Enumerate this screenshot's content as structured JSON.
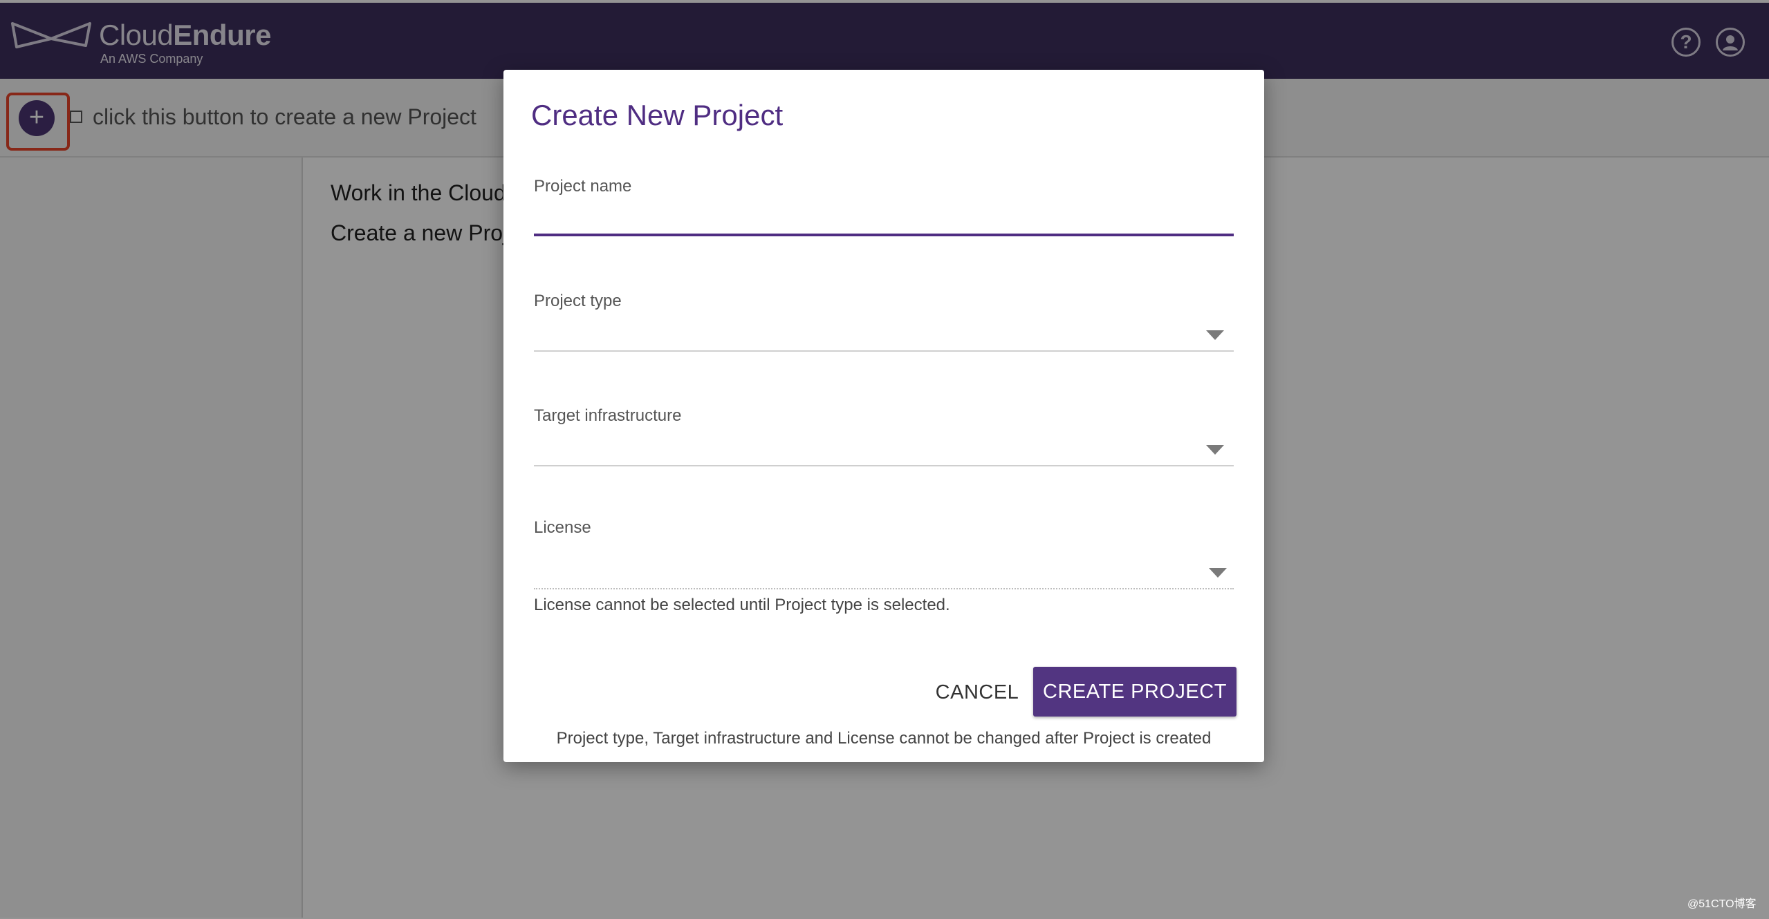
{
  "header": {
    "brand_light": "Cloud",
    "brand_bold": "Endure",
    "brand_sub": "An AWS Company",
    "help_icon": "?",
    "user_icon": "user-icon"
  },
  "toolbar": {
    "add_symbol": "+",
    "hint": "click this button to create a new Project"
  },
  "main": {
    "line1": "Work in the Cloud",
    "line2": "Create a new Proj"
  },
  "modal": {
    "title": "Create New Project",
    "fields": {
      "project_name": {
        "label": "Project name",
        "value": "",
        "placeholder": ""
      },
      "project_type": {
        "label": "Project type",
        "value": ""
      },
      "target_infrastructure": {
        "label": "Target infrastructure",
        "value": ""
      },
      "license": {
        "label": "License",
        "value": "",
        "helper": "License cannot be selected until Project type is selected."
      }
    },
    "cancel_label": "CANCEL",
    "create_label": "CREATE PROJECT",
    "footer_note": "Project type, Target infrastructure and License cannot be changed after Project is created"
  },
  "colors": {
    "header_bg": "#3d2f5e",
    "accent": "#523581",
    "title": "#4f2d82",
    "highlight": "#e8442a"
  },
  "watermark": "@51CTO博客"
}
